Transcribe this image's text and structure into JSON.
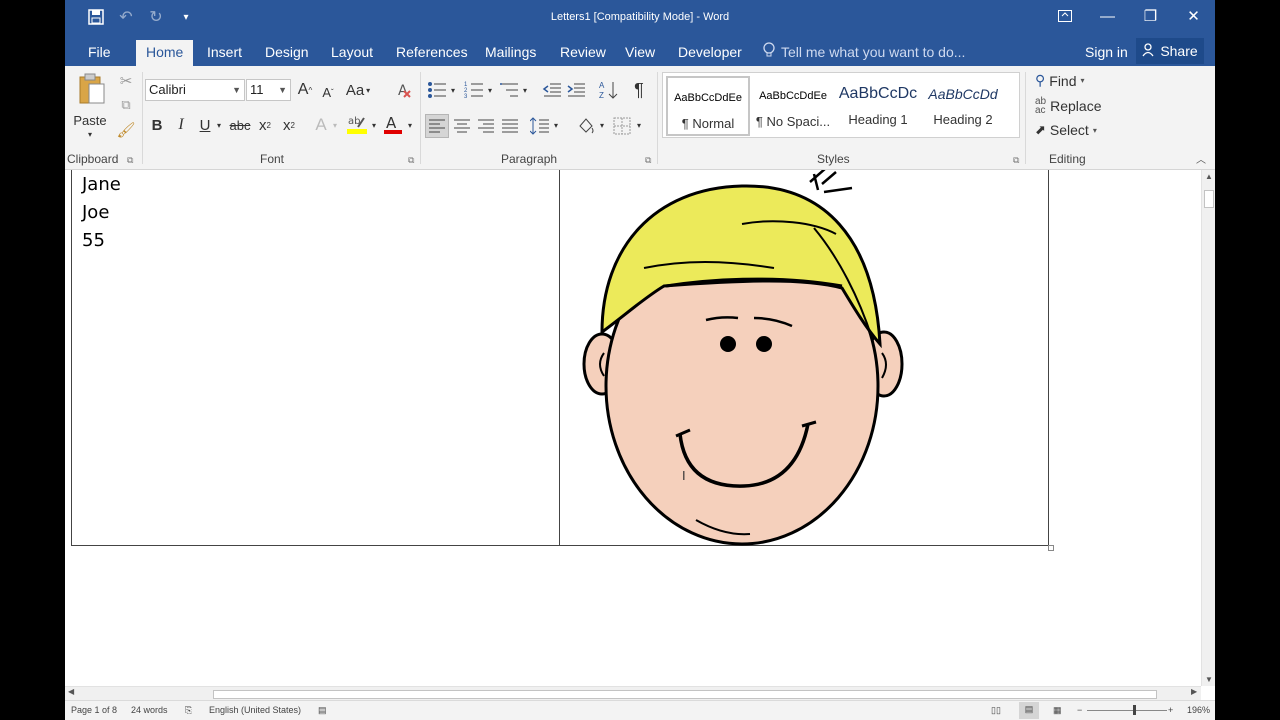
{
  "window": {
    "title": "Letters1 [Compatibility Mode] - Word"
  },
  "tabs": [
    {
      "label": "File"
    },
    {
      "label": "Home"
    },
    {
      "label": "Insert"
    },
    {
      "label": "Design"
    },
    {
      "label": "Layout"
    },
    {
      "label": "References"
    },
    {
      "label": "Mailings"
    },
    {
      "label": "Review"
    },
    {
      "label": "View"
    },
    {
      "label": "Developer"
    }
  ],
  "tell_me": {
    "placeholder": "Tell me what you want to do..."
  },
  "account": {
    "signin": "Sign in",
    "share": "Share"
  },
  "clipboard": {
    "paste": "Paste",
    "label": "Clipboard"
  },
  "font": {
    "name": "Calibri",
    "size": "11",
    "label": "Font",
    "change_case": "Aa"
  },
  "paragraph": {
    "label": "Paragraph"
  },
  "styles": {
    "label": "Styles",
    "items": [
      {
        "sample": "AaBbCcDdEe",
        "name": "¶ Normal"
      },
      {
        "sample": "AaBbCcDdEe",
        "name": "¶ No Spaci..."
      },
      {
        "sample": "AaBbCcDc",
        "name": "Heading 1"
      },
      {
        "sample": "AaBbCcDd",
        "name": "Heading 2"
      }
    ]
  },
  "editing": {
    "label": "Editing",
    "find": "Find",
    "replace": "Replace",
    "select": "Select"
  },
  "document": {
    "lines": [
      "Jane",
      "Joe",
      "55"
    ]
  },
  "statusbar": {
    "page": "Page 1 of 8",
    "words": "24 words",
    "language": "English (United States)",
    "zoom": "196%"
  },
  "colors": {
    "word_blue": "#2b579a",
    "ribbon_bg": "#f3f3f3",
    "hair": "#ecea5a",
    "skin": "#f5d0bc"
  }
}
